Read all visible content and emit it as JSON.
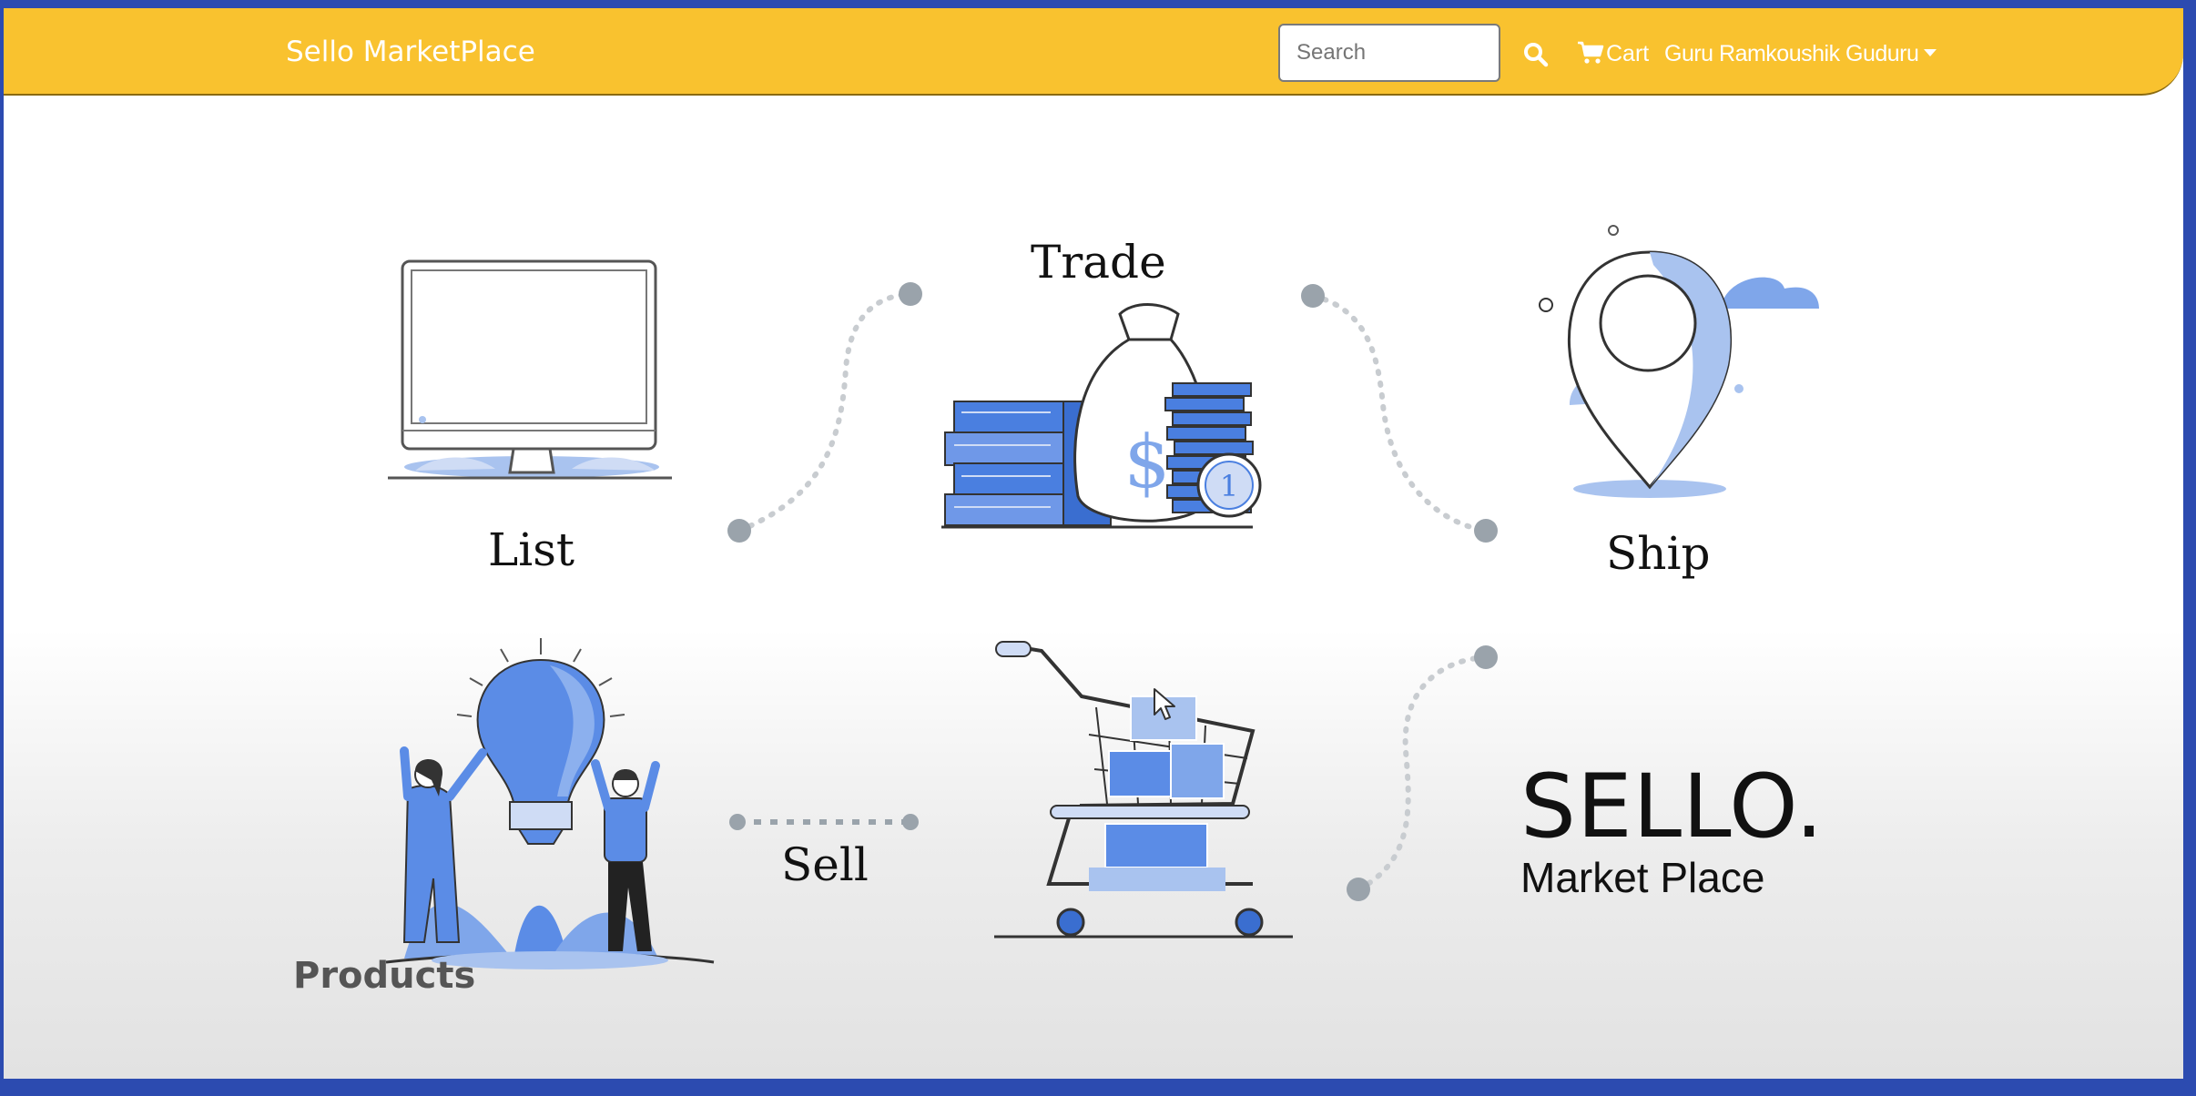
{
  "navbar": {
    "brand": "Sello MarketPlace",
    "search_placeholder": "Search",
    "cart_label": "Cart",
    "user_name": "Guru Ramkoushik Guduru",
    "background_color": "#f9c22f"
  },
  "hero": {
    "steps": {
      "trade": "Trade",
      "list": "List",
      "ship": "Ship",
      "sell": "Sell"
    },
    "logo": {
      "title": "SELLO.",
      "subtitle": "Market Place"
    },
    "accent_color": "#4a7fe0"
  },
  "main": {
    "products_heading": "Products"
  },
  "icons": [
    "search-icon",
    "cart-icon",
    "caret-down-icon",
    "monitor-icon",
    "money-bag-icon",
    "map-pin-icon",
    "lightbulb-people-icon",
    "shopping-cart-icon",
    "mouse-cursor-icon"
  ]
}
